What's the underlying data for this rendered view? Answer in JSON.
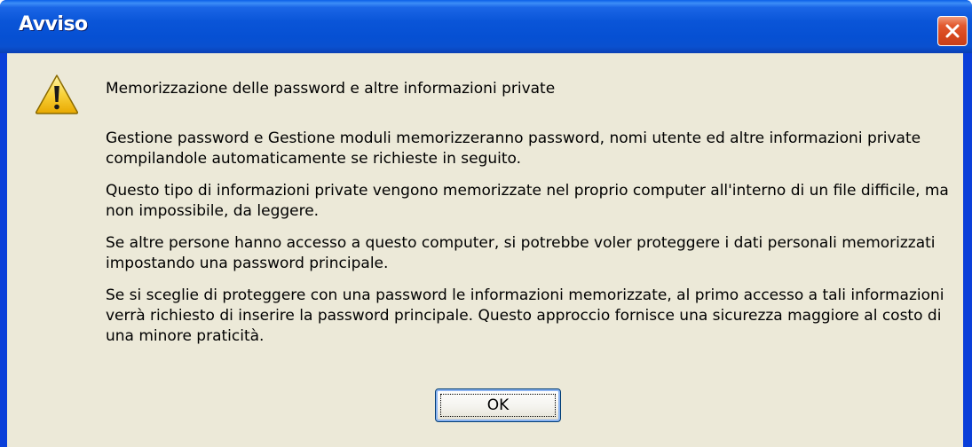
{
  "window": {
    "title": "Avviso",
    "close_icon": "close-icon"
  },
  "dialog": {
    "icon": "warning-icon",
    "heading": "Memorizzazione delle password e altre informazioni private",
    "paragraphs": [
      "Gestione password e Gestione moduli memorizzeranno password, nomi utente ed altre informazioni private compilandole automaticamente se richieste in seguito.",
      "Questo tipo di informazioni private vengono memorizzate nel proprio computer all'interno di un file difficile, ma non impossibile, da leggere.",
      "Se altre persone hanno accesso a questo computer, si potrebbe voler proteggere i dati personali memorizzati impostando una password principale.",
      "Se si sceglie di proteggere con una password le informazioni memorizzate, al primo accesso a tali informazioni verrà richiesto di inserire la password principale. Questo approccio fornisce una sicurezza maggiore al costo di una minore praticità."
    ],
    "ok_label": "OK"
  },
  "colors": {
    "titlebar": "#0a55d8",
    "client": "#ece9d8",
    "close_button": "#d7481e"
  }
}
